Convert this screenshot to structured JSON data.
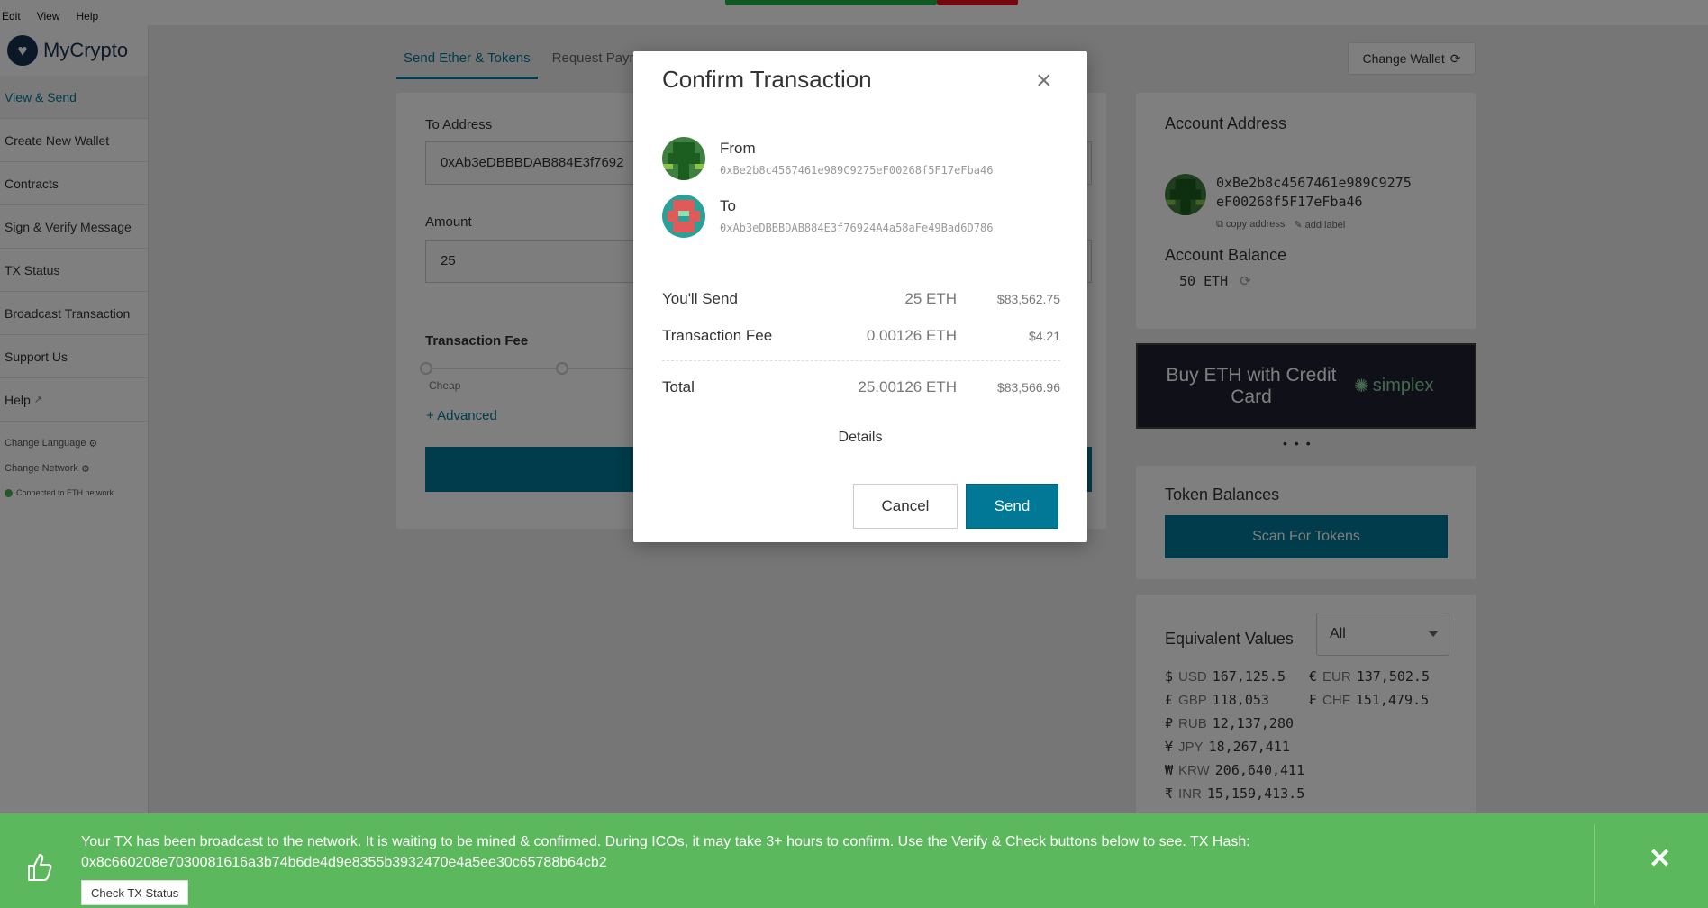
{
  "menubar": {
    "items": [
      "Edit",
      "View",
      "Help"
    ]
  },
  "app": {
    "logo_text": "MyCrypto"
  },
  "sidebar": {
    "items": [
      {
        "label": "View & Send"
      },
      {
        "label": "Create New Wallet"
      },
      {
        "label": "Contracts"
      },
      {
        "label": "Sign & Verify Message"
      },
      {
        "label": "TX Status"
      },
      {
        "label": "Broadcast Transaction"
      },
      {
        "label": "Support Us"
      },
      {
        "label": "Help"
      }
    ],
    "change_language": "Change Language",
    "change_network": "Change Network",
    "connection_status": "Connected to ETH network"
  },
  "tabs": [
    "Send Ether & Tokens",
    "Request Payment"
  ],
  "send_form": {
    "to_address_label": "To Address",
    "to_address_value": "0xAb3eDBBBDAB884E3f7692",
    "amount_label": "Amount",
    "amount_value": "25",
    "fee_label": "Transaction Fee",
    "fee_cheap_label": "Cheap",
    "advanced_link": "+ Advanced"
  },
  "header": {
    "change_wallet": "Change Wallet"
  },
  "account": {
    "address_title": "Account Address",
    "address_line1": "0xBe2b8c4567461e989C9275",
    "address_line2": "eF00268f5F17eFba46",
    "copy_address": "copy address",
    "add_label": "add label",
    "balance_title": "Account Balance",
    "balance_value": "50 ETH"
  },
  "banner": {
    "text": "Buy ETH with Credit Card",
    "brand": "simplex"
  },
  "tokens": {
    "title": "Token Balances",
    "scan_button": "Scan For Tokens"
  },
  "equivalent": {
    "title": "Equivalent Values",
    "selected": "All",
    "rows": [
      [
        {
          "sym": "$",
          "cur": "USD",
          "val": "167,125.5"
        },
        {
          "sym": "€",
          "cur": "EUR",
          "val": "137,502.5"
        }
      ],
      [
        {
          "sym": "£",
          "cur": "GBP",
          "val": "118,053"
        },
        {
          "sym": "₣",
          "cur": "CHF",
          "val": "151,479.5"
        }
      ],
      [
        {
          "sym": "₽",
          "cur": "RUB",
          "val": "12,137,280"
        }
      ],
      [
        {
          "sym": "¥",
          "cur": "JPY",
          "val": "18,267,411"
        }
      ],
      [
        {
          "sym": "₩",
          "cur": "KRW",
          "val": "206,640,411"
        }
      ],
      [
        {
          "sym": "₹",
          "cur": "INR",
          "val": "15,159,413.5"
        }
      ]
    ]
  },
  "modal": {
    "title": "Confirm Transaction",
    "from_label": "From",
    "from_address": "0xBe2b8c4567461e989C9275eF00268f5F17eFba46",
    "to_label": "To",
    "to_address": "0xAb3eDBBBDAB884E3f76924A4a58aFe49Bad6D786",
    "send_label": "You'll Send",
    "send_eth": "25 ETH",
    "send_usd": "$83,562.75",
    "fee_label": "Transaction Fee",
    "fee_eth": "0.00126 ETH",
    "fee_usd": "$4.21",
    "total_label": "Total",
    "total_eth": "25.00126 ETH",
    "total_usd": "$83,566.96",
    "details": "Details",
    "cancel": "Cancel",
    "send": "Send"
  },
  "notification": {
    "message": "Your TX has been broadcast to the network. It is waiting to be mined & confirmed. During ICOs, it may take 3+ hours to confirm. Use the Verify & Check buttons below to see. TX Hash: 0x8c660208e7030081616a3b74b6de4d9e8355b3932470e4a5ee30c65788b64cb2",
    "button": "Check TX Status"
  },
  "colors": {
    "primary": "#007896",
    "success": "#5cb85c",
    "brand": "#163151"
  }
}
